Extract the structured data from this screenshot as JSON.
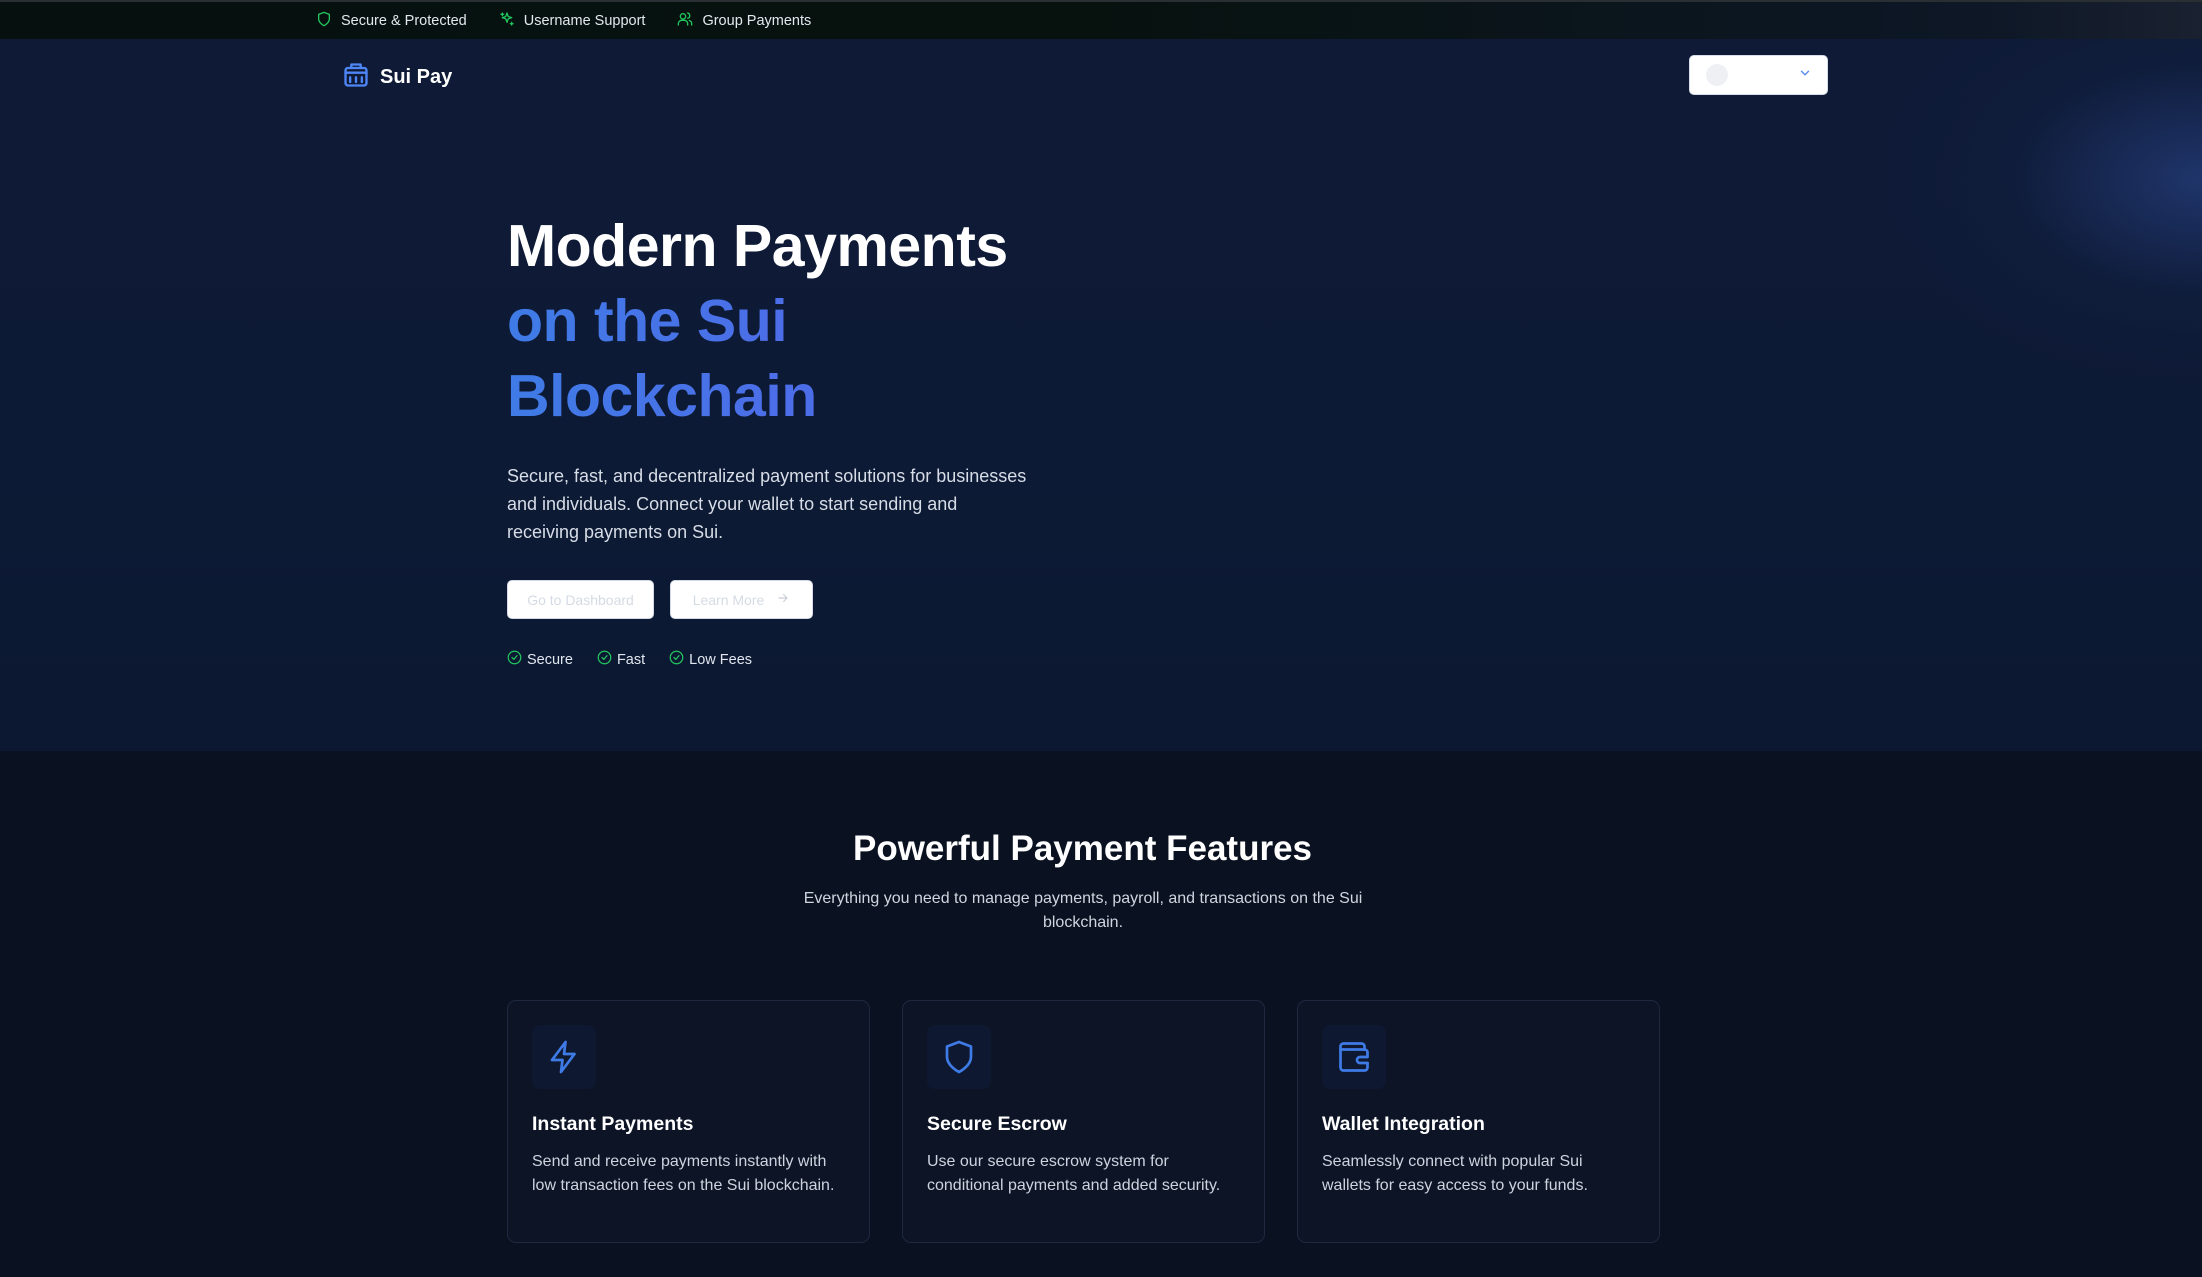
{
  "topbar": {
    "items": [
      {
        "label": "Secure & Protected",
        "icon": "shield-icon"
      },
      {
        "label": "Username Support",
        "icon": "sparkles-icon"
      },
      {
        "label": "Group Payments",
        "icon": "users-icon"
      }
    ]
  },
  "header": {
    "brand": "Sui Pay",
    "brand_icon": "building-icon",
    "wallet_icon": "chevron-down-icon"
  },
  "hero": {
    "title_line1": "Modern Payments",
    "title_line2": "on the Sui",
    "title_line3": "Blockchain",
    "description": "Secure, fast, and decentralized payment solutions for businesses and individuals. Connect your wallet to start sending and receiving payments on Sui.",
    "primary_button": "Go to Dashboard",
    "secondary_button": "Learn More",
    "badges": [
      "Secure",
      "Fast",
      "Low Fees"
    ]
  },
  "features": {
    "title": "Powerful Payment Features",
    "subtitle": "Everything you need to manage payments, payroll, and transactions on the Sui blockchain.",
    "cards": [
      {
        "title": "Instant Payments",
        "description": "Send and receive payments instantly with low transaction fees on the Sui blockchain.",
        "icon": "lightning-icon"
      },
      {
        "title": "Secure Escrow",
        "description": "Use our secure escrow system for conditional payments and added security.",
        "icon": "shield-icon"
      },
      {
        "title": "Wallet Integration",
        "description": "Seamlessly connect with popular Sui wallets for easy access to your funds.",
        "icon": "wallet-icon"
      }
    ]
  },
  "colors": {
    "accent_blue": "#3f7be6",
    "accent_indigo": "#5561e6",
    "success_green": "#22c55e",
    "background": "#0a1120",
    "hero_background": "#0e1a36"
  }
}
